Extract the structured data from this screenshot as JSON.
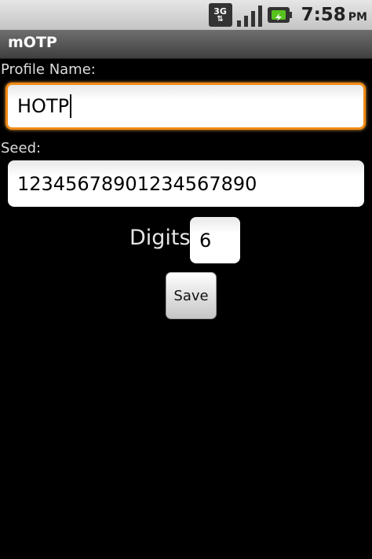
{
  "status_bar": {
    "network_label": "3G",
    "network_arrows": "⇅",
    "signal_strength_bars": 4,
    "battery_level": "charging",
    "time": "7:58",
    "ampm": "PM",
    "icons": [
      "network-3g-icon",
      "signal-icon",
      "battery-icon"
    ]
  },
  "title_bar": {
    "title": "mOTP"
  },
  "form": {
    "profile_name_label": "Profile Name:",
    "profile_name_value": "HOTP",
    "seed_label": "Seed:",
    "seed_value": "12345678901234567890",
    "digits_label": "Digits",
    "digits_value": "6",
    "save_label": "Save"
  },
  "colors": {
    "background": "#000000",
    "focus_border": "#f08a14",
    "battery_fill": "#58c21e"
  }
}
